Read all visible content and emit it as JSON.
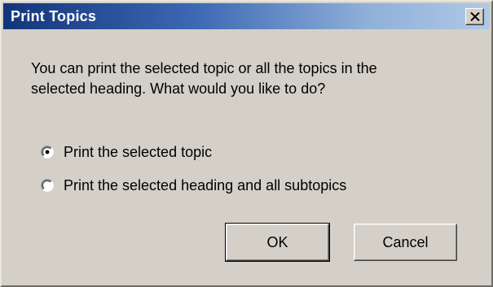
{
  "window": {
    "title": "Print Topics",
    "close_glyph": "×"
  },
  "message": {
    "line1": "You can print the selected topic or all the topics in the",
    "line2": "selected heading. What would you like to do?"
  },
  "options": [
    {
      "label": "Print the selected topic",
      "selected": true
    },
    {
      "label": "Print the selected heading and all subtopics",
      "selected": false
    }
  ],
  "buttons": {
    "ok_label": "OK",
    "cancel_label": "Cancel"
  },
  "colors": {
    "face": "#d4d0c8",
    "title_start": "#12357a",
    "title_end": "#b0c9e6"
  }
}
